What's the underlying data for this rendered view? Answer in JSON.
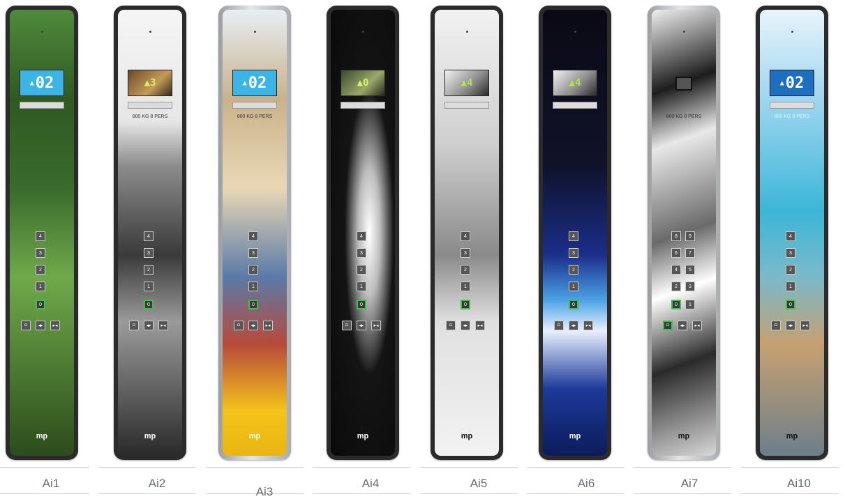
{
  "panels": [
    {
      "caption": "Ai1",
      "floor": "02",
      "arrow": "▲"
    },
    {
      "caption": "Ai2",
      "floor": "3",
      "arrow": "▲",
      "capacity": "800 KG 8 PERS"
    },
    {
      "caption": "Ai3",
      "floor": "02",
      "arrow": "▲",
      "capacity": "800 KG 8 PERS"
    },
    {
      "caption": "Ai4",
      "floor": "0",
      "arrow": "▲"
    },
    {
      "caption": "Ai5",
      "floor": "4",
      "arrow": "▲"
    },
    {
      "caption": "Ai6",
      "floor": "4",
      "arrow": "▲"
    },
    {
      "caption": "Ai7",
      "capacity": "800 KG 8 PERS"
    },
    {
      "caption": "Ai10",
      "floor": "02",
      "arrow": "▲",
      "capacity": "800 KG 8 PERS"
    }
  ],
  "buttons": {
    "b4": "4",
    "b3": "3",
    "b2": "2",
    "b1": "1",
    "b0": "0",
    "b5": "5",
    "b6": "6",
    "b7": "7",
    "b8": "8",
    "b9": "9"
  },
  "logo": "mp",
  "colors": {
    "display_blue": "#3cb4e6",
    "button_green": "#3ac24a",
    "caption_gray": "#666b75"
  }
}
